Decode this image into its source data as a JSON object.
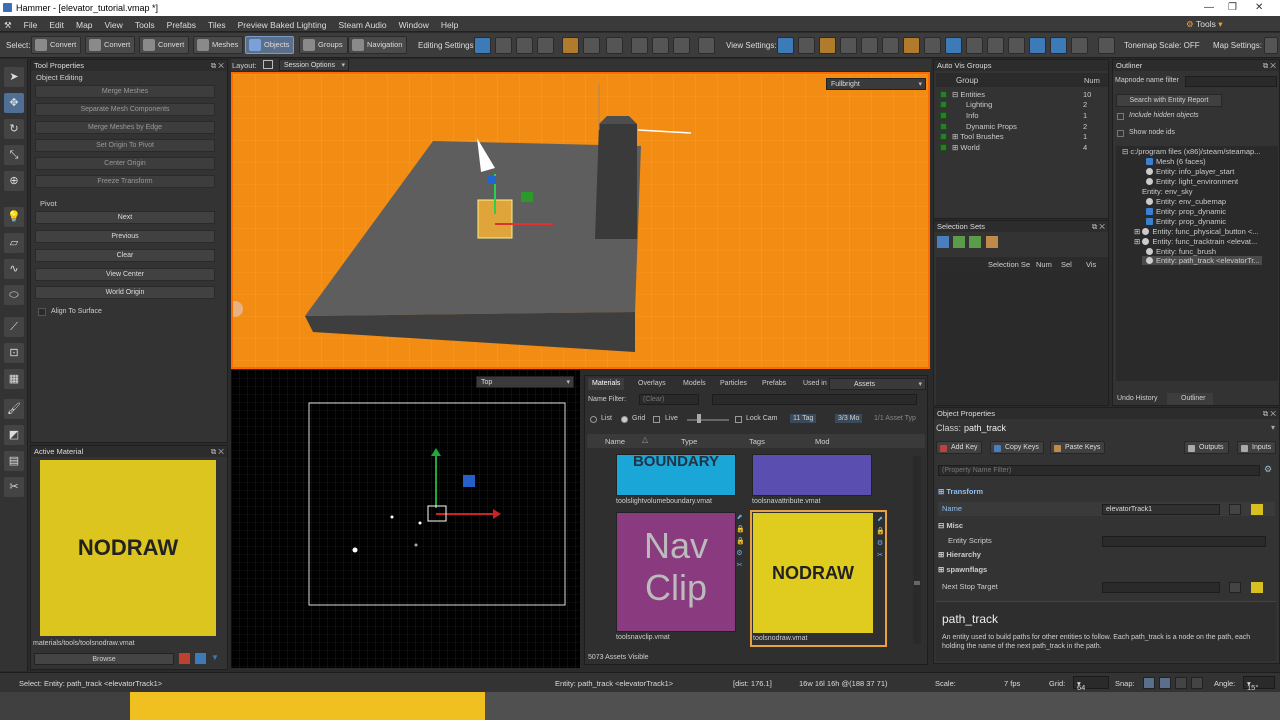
{
  "window": {
    "title": "Hammer - [elevator_tutorial.vmap *]"
  },
  "menu": [
    "File",
    "Edit",
    "Map",
    "View",
    "Tools",
    "Prefabs",
    "Tiles",
    "Preview Baked Lighting",
    "Steam Audio",
    "Window",
    "Help"
  ],
  "menu_right": {
    "tools": "Tools"
  },
  "toolbar": {
    "select_label": "Select:",
    "convert1": "Convert",
    "convert2": "Convert",
    "convert3": "Convert",
    "meshes": "Meshes",
    "objects": "Objects",
    "groups": "Groups",
    "navigation": "Navigation",
    "editing_settings": "Editing Settings:",
    "view_settings": "View Settings:",
    "tonemap": "Tonemap Scale: OFF",
    "map_settings": "Map Settings:"
  },
  "tool_properties": {
    "title": "Tool Properties",
    "section": "Object Editing",
    "buttons": [
      "Merge Meshes",
      "Separate Mesh Components",
      "Merge Meshes by Edge",
      "Set Origin To Pivot",
      "Center Origin",
      "Freeze Transform"
    ],
    "pivot_label": "Pivot",
    "pivot_buttons": [
      "Next",
      "Previous",
      "Clear",
      "View Center",
      "World Origin"
    ],
    "align_surface": "Align To Surface"
  },
  "active_material": {
    "title": "Active Material",
    "preview_text": "NODRAW",
    "path": "materials/tools/toolsnodraw.vmat",
    "browse": "Browse"
  },
  "layout": {
    "label": "Layout:",
    "session": "Session Options"
  },
  "viewport3d": {
    "mode": "Fullbright"
  },
  "viewport2d": {
    "view": "Top"
  },
  "materials": {
    "tabs": [
      "Materials",
      "Overlays",
      "Models",
      "Particles",
      "Prefabs",
      "Used in"
    ],
    "assets_dropdown": "Assets",
    "name_filter_label": "Name Filter:",
    "name_filter_placeholder": "(Clear)",
    "view_list": "List",
    "view_grid": "Grid",
    "live": "Live",
    "lock_cam": "Lock Cam",
    "tag_count": "11 Tag",
    "mod_count": "3/3 Mo",
    "asset_type": "1/1 Asset Typ",
    "columns": [
      "Name",
      "Type",
      "Tags",
      "Mod"
    ],
    "items": [
      {
        "name": "toolslightvolumeboundary.vmat",
        "text": "BOUNDARY",
        "color": "#1aa6d6"
      },
      {
        "name": "toolsnavattribute.vmat",
        "text": "",
        "color": "#5a4fb0"
      },
      {
        "name": "toolsnavclip.vmat",
        "text1": "Nav",
        "text2": "Clip",
        "color": "#8a3a7e"
      },
      {
        "name": "toolsnodraw.vmat",
        "text": "NODRAW",
        "color": "#e0cc1e"
      }
    ],
    "assets_visible": "5073 Assets Visible"
  },
  "auto_vis": {
    "title": "Auto Vis Groups",
    "col_group": "Group",
    "col_num": "Num",
    "rows": [
      {
        "label": "Entities",
        "num": "10"
      },
      {
        "label": "Lighting",
        "num": "2"
      },
      {
        "label": "Info",
        "num": "1"
      },
      {
        "label": "Dynamic Props",
        "num": "2"
      },
      {
        "label": "Tool Brushes",
        "num": "1"
      },
      {
        "label": "World",
        "num": "4"
      }
    ]
  },
  "selection_sets": {
    "title": "Selection Sets",
    "cols": [
      "Selection Se",
      "Num",
      "Sel",
      "Vis"
    ]
  },
  "outliner": {
    "title": "Outliner",
    "filter_label": "Mapnode name filter",
    "search_btn": "Search with Entity Report",
    "include_hidden": "Include hidden objects",
    "show_ids": "Show node ids",
    "tree": [
      "c:/program files (x86)/steam/steamap...",
      "Mesh (6 faces)",
      "Entity: info_player_start",
      "Entity: light_environment",
      "Entity: env_sky",
      "Entity: env_cubemap",
      "Entity: prop_dynamic",
      "Entity: prop_dynamic",
      "Entity: func_physical_button <...",
      "Entity: func_tracktrain <elevat...",
      "Entity: func_brush",
      "Entity: path_track <elevatorTr..."
    ],
    "tabs": [
      "Undo History",
      "Outliner"
    ]
  },
  "object_properties": {
    "title": "Object Properties",
    "class_label": "Class:",
    "class_value": "path_track",
    "add_key": "Add Key",
    "copy_keys": "Copy Keys",
    "paste_keys": "Paste Keys",
    "outputs": "Outputs",
    "inputs": "Inputs",
    "filter_placeholder": "(Property Name Filter)",
    "transform": "Transform",
    "name_label": "Name",
    "name_value": "elevatorTrack1",
    "misc": "Misc",
    "entity_scripts": "Entity Scripts",
    "hierarchy": "Hierarchy",
    "spawnflags": "spawnflags",
    "next_stop": "Next Stop Target",
    "help_title": "path_track",
    "help_text": "An entity used to build paths for other entities to follow. Each path_track is a node on the path, each holding the name of the next path_track in the path."
  },
  "status": {
    "select": "Select: Entity: path_track <elevatorTrack1>",
    "entity": "Entity: path_track <elevatorTrack1>",
    "dist": "[dist: 176.1]",
    "dims": "16w 16l 16h @(188 37 71)",
    "scale": "Scale:",
    "fps": "7 fps",
    "grid_label": "Grid:",
    "grid_value": "64",
    "snap": "Snap:",
    "angle_label": "Angle:",
    "angle_value": "15°"
  }
}
